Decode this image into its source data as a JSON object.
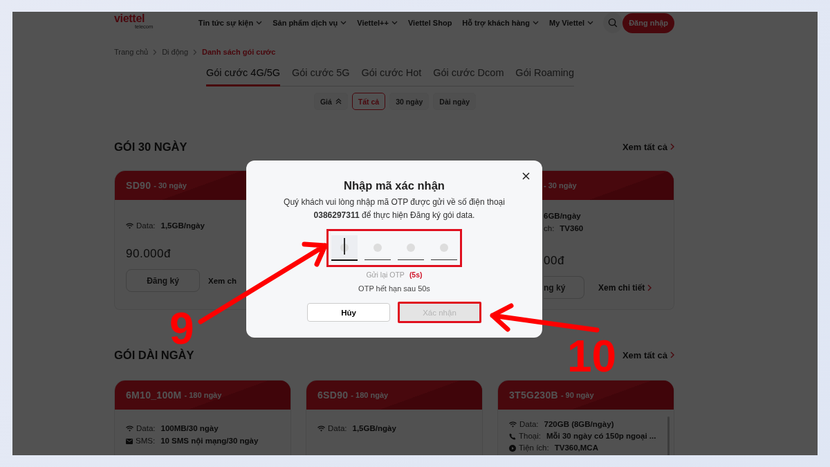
{
  "header": {
    "logo": "viettel",
    "logo_sub": "telecom",
    "nav": [
      {
        "label": "Tin tức sự kiện",
        "dropdown": true
      },
      {
        "label": "Sản phẩm dịch vụ",
        "dropdown": true
      },
      {
        "label": "Viettel++",
        "dropdown": true
      },
      {
        "label": "Viettel Shop",
        "dropdown": false
      },
      {
        "label": "Hỗ trợ khách hàng",
        "dropdown": true
      },
      {
        "label": "My Viettel",
        "dropdown": true
      }
    ],
    "login": "Đăng nhập"
  },
  "breadcrumb": [
    {
      "label": "Trang chủ",
      "current": false
    },
    {
      "label": "Di động",
      "current": false
    },
    {
      "label": "Danh sách gói cước",
      "current": true
    }
  ],
  "tabs": [
    {
      "label": "Gói cước 4G/5G",
      "selected": true
    },
    {
      "label": "Gói cước 5G",
      "selected": false
    },
    {
      "label": "Gói cước Hot",
      "selected": false
    },
    {
      "label": "Gói cước Dcom",
      "selected": false
    },
    {
      "label": "Gói Roaming",
      "selected": false
    }
  ],
  "filters": [
    {
      "kind": "sort",
      "label": "Giá",
      "selected": false
    },
    {
      "kind": "chip",
      "label": "Tất cả",
      "selected": true
    },
    {
      "kind": "chip",
      "label": "30 ngày",
      "selected": false
    },
    {
      "kind": "chip",
      "label": "Dài ngày",
      "selected": false
    }
  ],
  "sections": [
    {
      "title": "GÓI 30 NGÀY",
      "see_all": "Xem tất cả",
      "cards": [
        {
          "kind": "left_fragment",
          "name": "SD90",
          "duration": "- 30 ngày",
          "features": [
            {
              "kind": "data",
              "label": "Data:",
              "value": "1,5GB/ngày"
            }
          ],
          "price": "90.000đ",
          "register": "Đăng ký",
          "details": "Xem ch"
        },
        {
          "kind": "right_fragment",
          "duration": "- 30 ngày",
          "features": [
            {
              "value": "6GB/ngày"
            },
            {
              "label": "ch:",
              "value": "TV360"
            }
          ],
          "price": "00đ",
          "register": "ng ký",
          "details": "Xem chi tiết"
        }
      ]
    },
    {
      "title": "GÓI DÀI NGÀY",
      "see_all": "Xem tất cả",
      "cards": [
        {
          "kind": "full",
          "name": "6M10_100M",
          "duration": "- 180 ngày",
          "features": [
            {
              "kind": "data",
              "label": "Data:",
              "value": "100MB/30 ngày"
            },
            {
              "kind": "sms",
              "label": "SMS:",
              "value": "10 SMS nội mạng/30 ngày"
            }
          ]
        },
        {
          "kind": "full",
          "name": "6SD90",
          "duration": "- 180 ngày",
          "features": [
            {
              "kind": "data",
              "label": "Data:",
              "value": "1,5GB/ngày"
            }
          ]
        },
        {
          "kind": "full",
          "name": "3T5G230B",
          "duration": "- 90 ngày",
          "features": [
            {
              "kind": "data",
              "label": "Data:",
              "value": "720GB (8GB/ngày)"
            },
            {
              "kind": "voice",
              "label": "Thoại:",
              "value": "Mỗi 30 ngày có 150p ngoại ..."
            },
            {
              "kind": "utility",
              "label": "Tiện ích:",
              "value": "TV360,MCA"
            }
          ]
        }
      ]
    }
  ],
  "modal": {
    "title": "Nhập mã xác nhận",
    "message_lines": [
      "Quý khách vui lòng nhập mã OTP được gửi về số điện thoại",
      "**0386297311** để thực hiện Đăng ký gói data."
    ],
    "otp_highlighted": true,
    "otp_slots": [
      {
        "focused": true
      },
      {
        "focused": false
      },
      {
        "focused": false
      },
      {
        "focused": false
      }
    ],
    "resend": "Gửi lại OTP",
    "countdown": "(5s)",
    "expiry": "OTP hết hạn sau 50s",
    "cancel": "Hủy",
    "confirm": {
      "label": "Xác nhận",
      "disabled": true,
      "highlighted": true
    }
  },
  "annotations": [
    {
      "label": "9"
    },
    {
      "label": "10"
    }
  ]
}
